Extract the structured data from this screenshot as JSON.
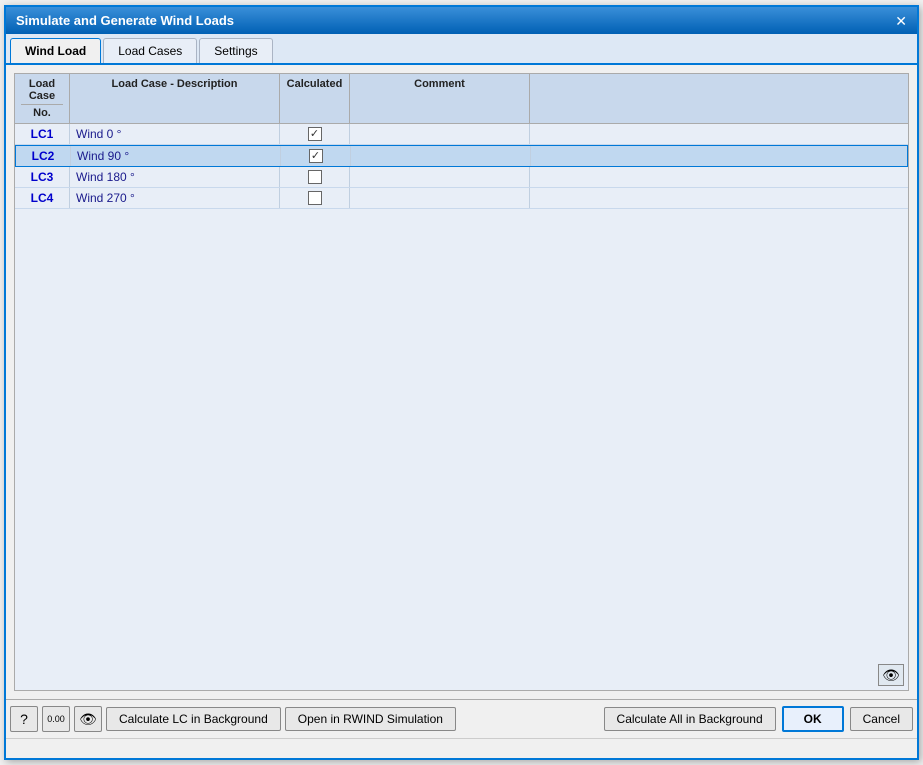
{
  "window": {
    "title": "Simulate and Generate Wind Loads",
    "close_label": "✕"
  },
  "tabs": [
    {
      "id": "wind-load",
      "label": "Wind Load",
      "active": true
    },
    {
      "id": "load-cases",
      "label": "Load Cases",
      "active": false
    },
    {
      "id": "settings",
      "label": "Settings",
      "active": false
    }
  ],
  "table": {
    "headers": {
      "col1_top": "Load Case",
      "col1_bottom": "No.",
      "col2": "Load Case - Description",
      "col3": "Calculated",
      "col4": "Comment",
      "col5": ""
    },
    "rows": [
      {
        "no": "LC1",
        "description": "Wind 0 °",
        "calculated": true,
        "comment": "",
        "selected": false
      },
      {
        "no": "LC2",
        "description": "Wind 90 °",
        "calculated": true,
        "comment": "",
        "selected": true
      },
      {
        "no": "LC3",
        "description": "Wind 180 °",
        "calculated": false,
        "comment": "",
        "selected": false
      },
      {
        "no": "LC4",
        "description": "Wind 270 °",
        "calculated": false,
        "comment": "",
        "selected": false
      }
    ]
  },
  "toolbar": {
    "help_icon": "?",
    "value_icon": "0.00",
    "eye_icon": "👁",
    "calc_lc_bg_label": "Calculate LC in Background",
    "open_rwind_label": "Open in RWIND Simulation",
    "calc_all_bg_label": "Calculate All in Background",
    "ok_label": "OK",
    "cancel_label": "Cancel"
  },
  "eye_icon_unicode": "👁",
  "status_bar": ""
}
